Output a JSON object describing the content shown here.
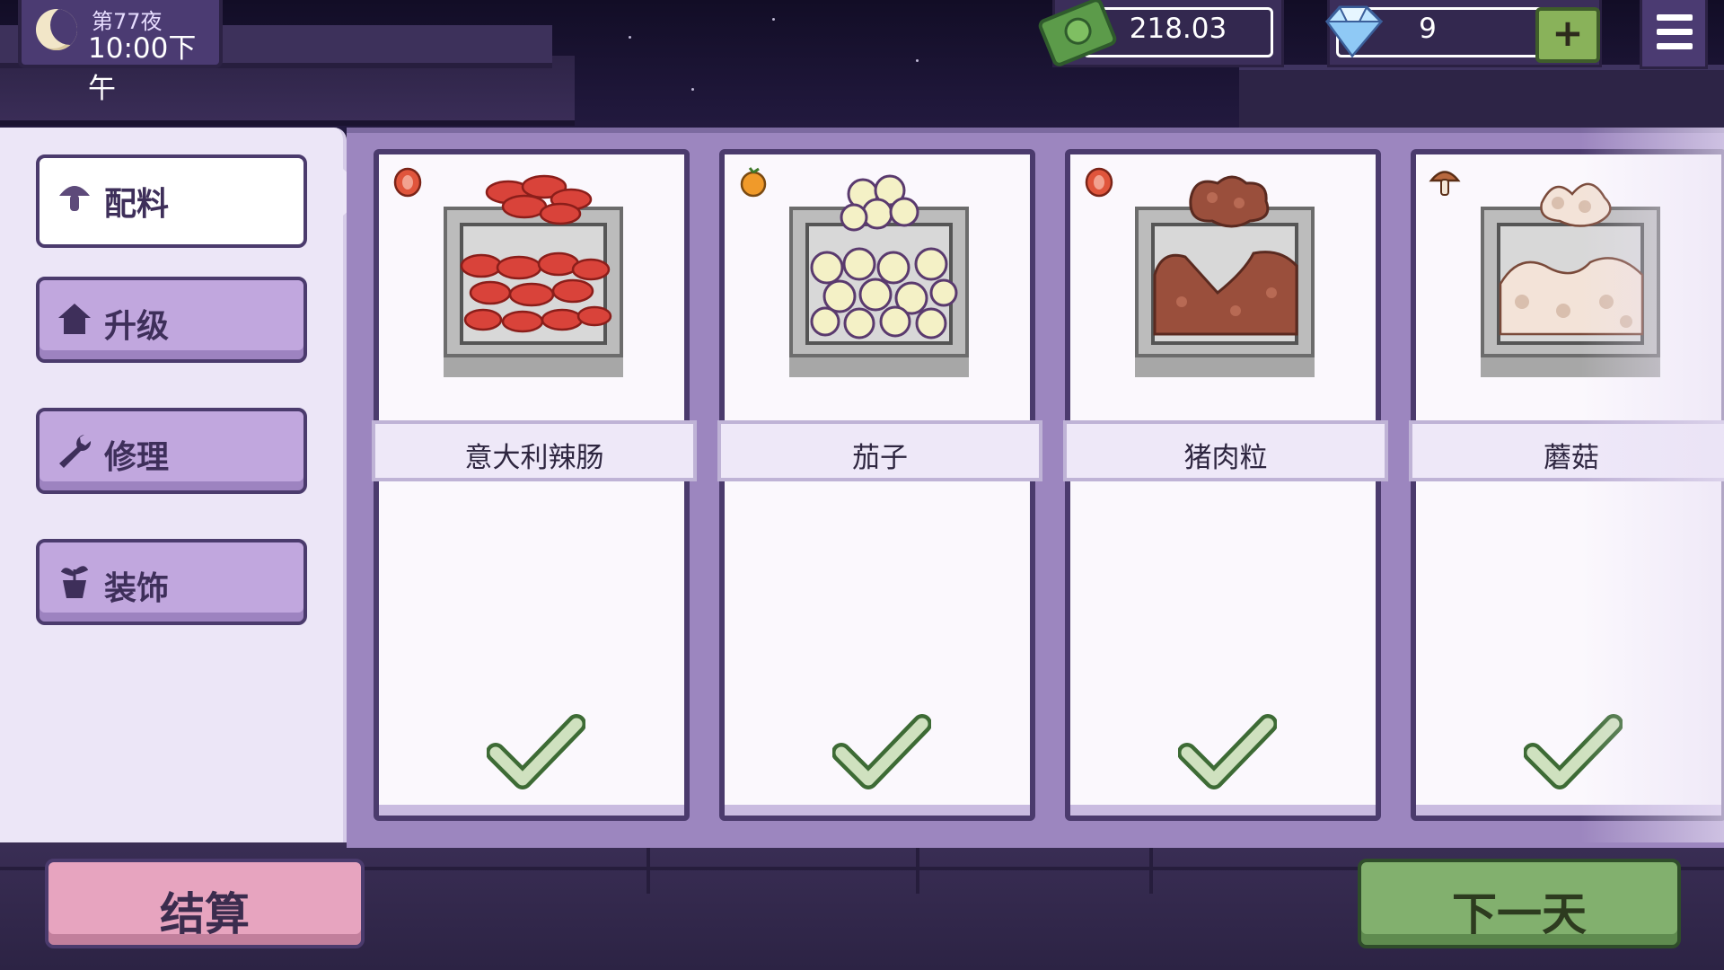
{
  "hud": {
    "night_label": "第77夜",
    "time_label": "10:00下午",
    "money_value": "218.03",
    "gems_value": "9",
    "add_gems_label": "+"
  },
  "sidebar": {
    "tabs": [
      {
        "label": "配料",
        "icon": "mushroom-icon",
        "active": true
      },
      {
        "label": "升级",
        "icon": "house-icon",
        "active": false
      },
      {
        "label": "修理",
        "icon": "wrench-icon",
        "active": false
      },
      {
        "label": "装饰",
        "icon": "plant-pot-icon",
        "active": false
      }
    ]
  },
  "ingredients": [
    {
      "name": "意大利辣肠",
      "category_icon": "meat-icon",
      "owned": true
    },
    {
      "name": "茄子",
      "category_icon": "orange-icon",
      "owned": true
    },
    {
      "name": "猪肉粒",
      "category_icon": "meat-icon",
      "owned": true
    },
    {
      "name": "蘑菇",
      "category_icon": "mushroom-icon",
      "owned": true
    }
  ],
  "buttons": {
    "settle_label": "结算",
    "next_day_label": "下一天"
  },
  "colors": {
    "panel_purple": "#9c86bf",
    "outline": "#4b3b6d",
    "settle_pink": "#e7a4bf",
    "next_day_green": "#82b06e",
    "check_green": "#cfe1bf"
  }
}
